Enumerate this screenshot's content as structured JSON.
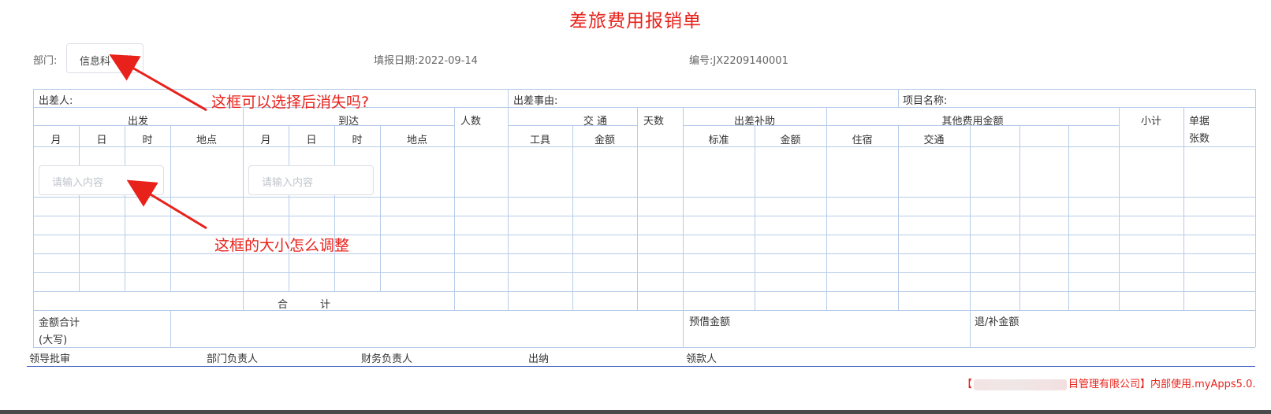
{
  "title": "差旅费用报销单",
  "header": {
    "dept_label": "部门:",
    "dept_value": "信息科",
    "date_label": "填报日期:",
    "date_value": "2022-09-14",
    "serial_label": "编号:",
    "serial_value": "JX2209140001"
  },
  "form": {
    "traveler_label": "出差人:",
    "reason_label": "出差事由:",
    "project_label": "项目名称:",
    "depart_label": "出发",
    "arrive_label": "到达",
    "people_label": "人数",
    "transport_label": "交 通",
    "days_label": "天数",
    "allowance_label": "出差补助",
    "other_label": "其他费用金额",
    "subtotal_label": "小计",
    "voucher_label_1": "单据",
    "voucher_label_2": "张数",
    "month": "月",
    "day": "日",
    "hour": "时",
    "place": "地点",
    "tool": "工具",
    "amount": "金额",
    "standard": "标准",
    "lodging": "住宿",
    "traffic": "交通",
    "input_placeholder": "请输入内容",
    "total_label_1": "合",
    "total_label_2": "计",
    "sum_label_1": "金额合计",
    "sum_label_2": "(大写)",
    "advance_label": "预借金额",
    "refund_label": "退/补金额"
  },
  "signatures": {
    "leader": "领导批审",
    "dept_head": "部门负责人",
    "finance_head": "财务负责人",
    "cashier": "出纳",
    "payee": "领款人"
  },
  "annotations": {
    "note1": "这框可以选择后消失吗?",
    "note2": "这框的大小怎么调整"
  },
  "footer": {
    "prefix": "【",
    "suffix": "目管理有限公司】内部使用.myApps5.0."
  },
  "colors": {
    "accent": "#e8221b",
    "grid": "#b7cce8",
    "footer_rule": "#3a5bbf"
  }
}
